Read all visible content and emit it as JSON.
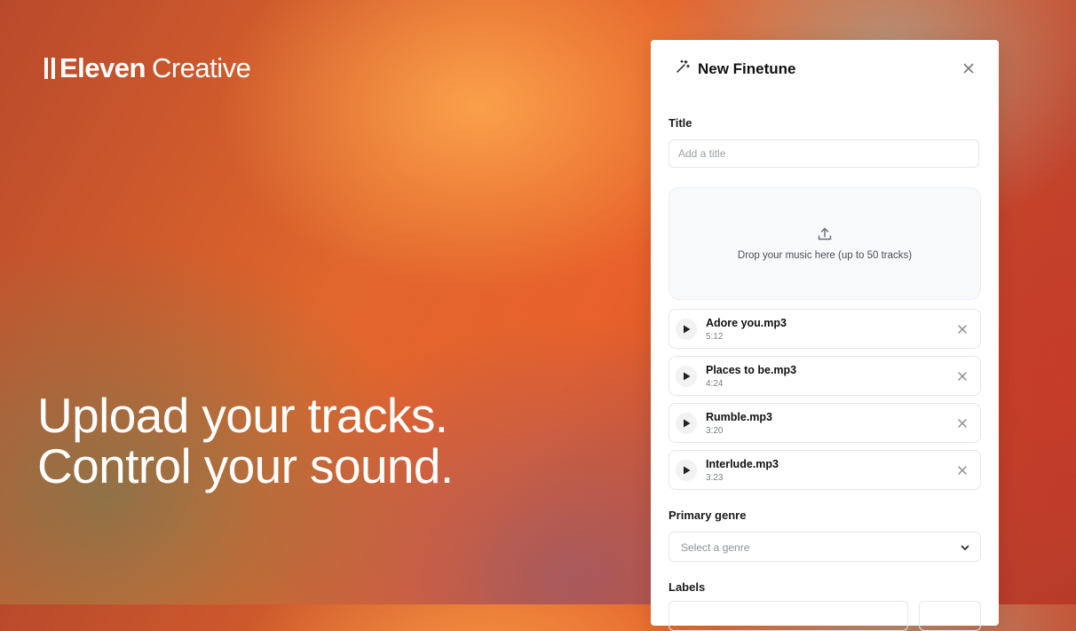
{
  "brand": {
    "name": "Eleven",
    "product": "Creative"
  },
  "headline": {
    "line1": "Upload your tracks.",
    "line2": "Control your sound."
  },
  "panel": {
    "title": "New Finetune",
    "title_field": {
      "label": "Title",
      "placeholder": "Add a title",
      "value": ""
    },
    "dropzone": {
      "text": "Drop your music here (up to 50 tracks)"
    },
    "tracks": [
      {
        "name": "Adore you.mp3",
        "duration": "5:12"
      },
      {
        "name": "Places to be.mp3",
        "duration": "4:24"
      },
      {
        "name": "Rumble.mp3",
        "duration": "3:20"
      },
      {
        "name": "Interlude.mp3",
        "duration": "3:23"
      }
    ],
    "genre": {
      "label": "Primary genre",
      "placeholder": "Select a genre"
    },
    "labels": {
      "label": "Labels"
    }
  },
  "icons": {
    "title": "magic-wand-icon",
    "close": "close-icon",
    "upload": "upload-icon",
    "play": "play-icon",
    "remove": "remove-icon",
    "chevron": "chevron-down-icon"
  }
}
